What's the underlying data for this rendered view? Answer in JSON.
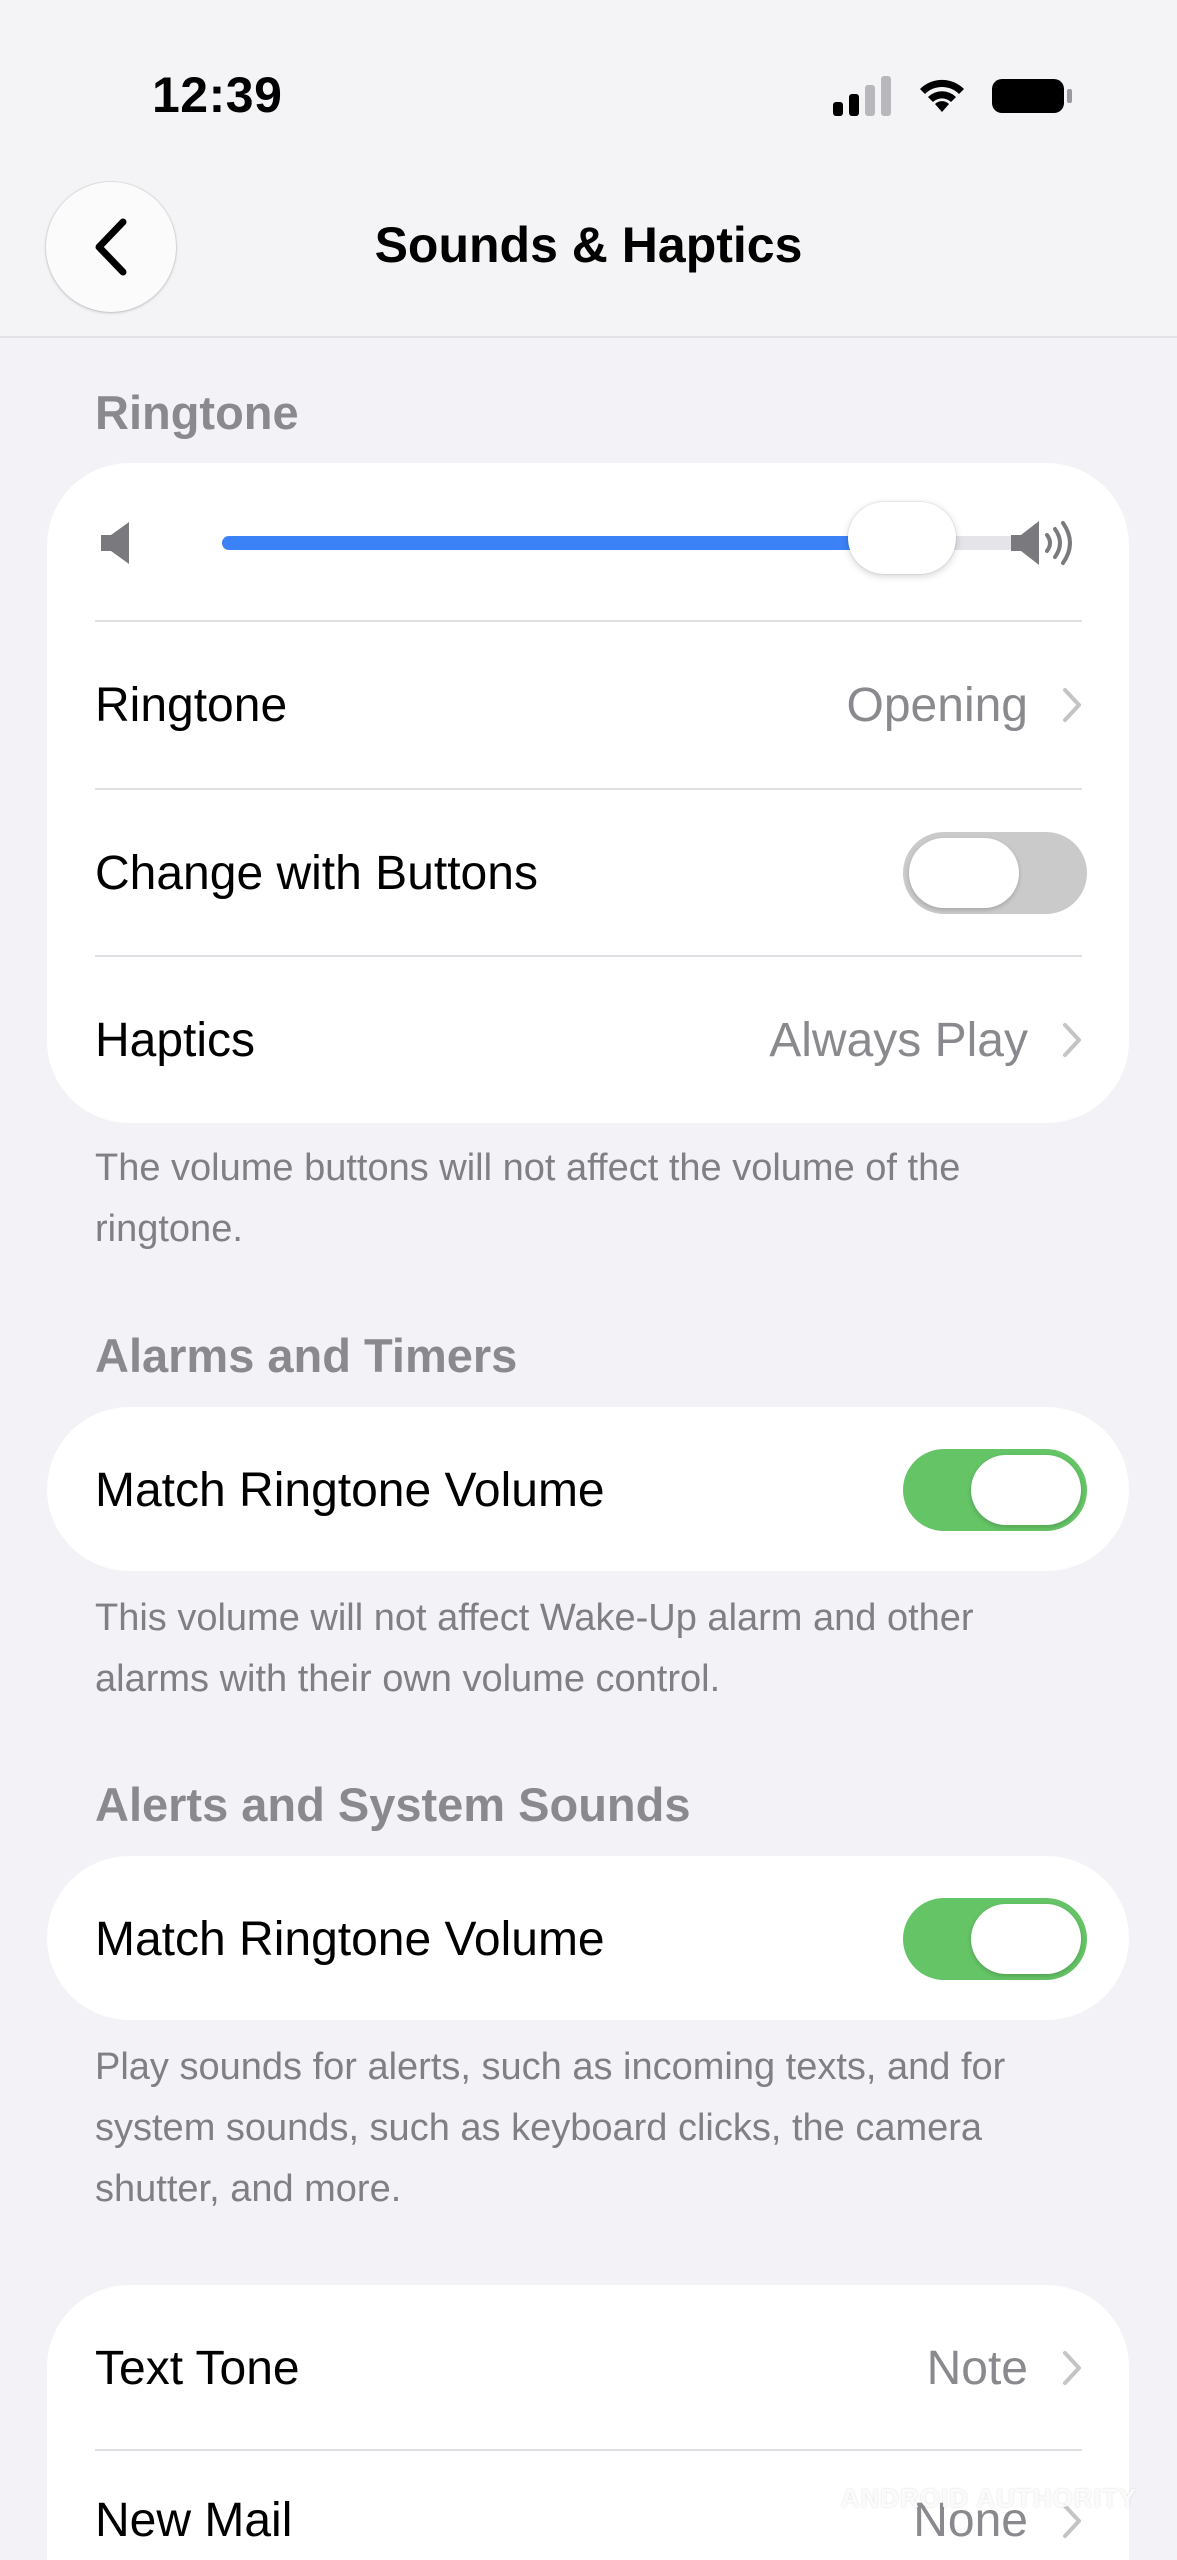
{
  "status_bar": {
    "time": "12:39"
  },
  "nav": {
    "title": "Sounds & Haptics"
  },
  "ringtone_section": {
    "header": "Ringtone",
    "volume_level": 0.85,
    "rows": {
      "ringtone": {
        "label": "Ringtone",
        "value": "Opening"
      },
      "change_with_buttons": {
        "label": "Change with Buttons",
        "on": false
      },
      "haptics": {
        "label": "Haptics",
        "value": "Always Play"
      }
    },
    "footnote": "The volume buttons will not affect the volume of the ringtone."
  },
  "alarms_section": {
    "header": "Alarms and Timers",
    "row": {
      "label": "Match Ringtone Volume",
      "on": true
    },
    "footnote": "This volume will not affect Wake-Up alarm and other alarms with their own volume control."
  },
  "alerts_section": {
    "header": "Alerts and System Sounds",
    "row": {
      "label": "Match Ringtone Volume",
      "on": true
    },
    "footnote": "Play sounds for alerts, such as incoming texts, and for system sounds, such as keyboard clicks, the camera shutter, and more."
  },
  "tones_section": {
    "rows": [
      {
        "label": "Text Tone",
        "value": "Note"
      },
      {
        "label": "New Mail",
        "value": "None"
      }
    ]
  },
  "watermark": "ANDROID AUTHORITY",
  "colors": {
    "accent_blue": "#3b82f6",
    "toggle_on": "#65c466",
    "toggle_off": "#cacaca"
  }
}
